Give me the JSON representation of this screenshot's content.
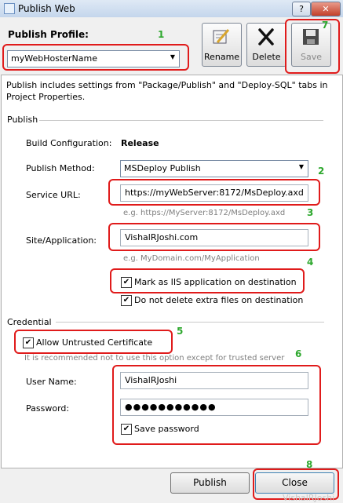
{
  "window": {
    "title": "Publish Web",
    "help_glyph": "?",
    "close_glyph": "✕"
  },
  "profile": {
    "label": "Publish Profile:",
    "selected": "myWebHosterName"
  },
  "toolbar": {
    "rename_label": "Rename",
    "delete_label": "Delete",
    "save_label": "Save"
  },
  "info_text": "Publish includes settings from \"Package/Publish\" and \"Deploy-SQL\" tabs in Project Properties.",
  "publish_section": {
    "title": "Publish",
    "build_config_label": "Build Configuration:",
    "build_config_value": "Release",
    "method_label": "Publish Method:",
    "method_value": "MSDeploy Publish",
    "service_url_label": "Service URL:",
    "service_url_value": "https://myWebServer:8172/MsDeploy.axd",
    "service_url_hint": "e.g. https://MyServer:8172/MsDeploy.axd",
    "site_label": "Site/Application:",
    "site_value": "VishalRJoshi.com",
    "site_hint": "e.g. MyDomain.com/MyApplication",
    "mark_iis_label": "Mark as IIS application on destination",
    "mark_iis_checked": true,
    "no_delete_label": "Do not delete extra files on destination",
    "no_delete_checked": true
  },
  "credential_section": {
    "title": "Credential",
    "allow_untrusted_label": "Allow Untrusted Certificate",
    "allow_untrusted_checked": true,
    "warning": "It is recommended not to use this option except for trusted server",
    "username_label": "User Name:",
    "username_value": "VishalRJoshi",
    "password_label": "Password:",
    "password_value": "●●●●●●●●●●●",
    "save_password_label": "Save password",
    "save_password_checked": true
  },
  "buttons": {
    "publish_label": "Publish",
    "close_label": "Close"
  },
  "annotations": [
    "1",
    "2",
    "3",
    "4",
    "5",
    "6",
    "7",
    "8"
  ],
  "watermark": "VishalRJoshi",
  "colors": {
    "annotation_box": "#e01b1b",
    "annotation_number": "#2ea82e"
  }
}
